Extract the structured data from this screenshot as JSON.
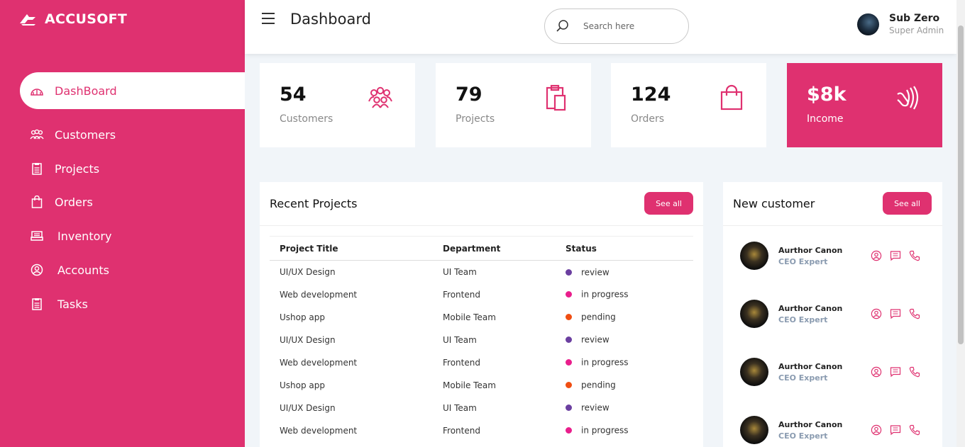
{
  "brand": {
    "name": "ACCUSOFT"
  },
  "colors": {
    "accent": "#df3170",
    "background": "#f1f5f9"
  },
  "sidebar": {
    "items": [
      {
        "label": "DashBoard",
        "icon": "dashboard-icon",
        "active": true
      },
      {
        "label": "Customers",
        "icon": "customers-icon"
      },
      {
        "label": "Projects",
        "icon": "projects-icon"
      },
      {
        "label": "Orders",
        "icon": "orders-icon"
      },
      {
        "label": "Inventory",
        "icon": "inventory-icon"
      },
      {
        "label": "Accounts",
        "icon": "accounts-icon"
      },
      {
        "label": "Tasks",
        "icon": "tasks-icon"
      }
    ]
  },
  "header": {
    "title": "Dashboard",
    "search_placeholder": "Search here",
    "search_value": "",
    "user": {
      "name": "Sub Zero",
      "role": "Super Admin"
    }
  },
  "stats": [
    {
      "value": "54",
      "label": "Customers",
      "icon": "people-group-icon"
    },
    {
      "value": "79",
      "label": "Projects",
      "icon": "clipboard-icon"
    },
    {
      "value": "124",
      "label": "Orders",
      "icon": "shopping-bag-icon"
    },
    {
      "value": "$8k",
      "label": "Income",
      "icon": "cash-wave-icon"
    }
  ],
  "recent_projects": {
    "title": "Recent Projects",
    "see_all": "See all",
    "columns": [
      "Project Title",
      "Department",
      "Status"
    ],
    "rows": [
      {
        "title": "UI/UX Design",
        "department": "UI Team",
        "status": "review",
        "color": "#6b3fa0"
      },
      {
        "title": "Web development",
        "department": "Frontend",
        "status": "in progress",
        "color": "#e91e8c"
      },
      {
        "title": "Ushop app",
        "department": "Mobile Team",
        "status": "pending",
        "color": "#f04e12"
      },
      {
        "title": "UI/UX Design",
        "department": "UI Team",
        "status": "review",
        "color": "#6b3fa0"
      },
      {
        "title": "Web development",
        "department": "Frontend",
        "status": "in progress",
        "color": "#e91e8c"
      },
      {
        "title": "Ushop app",
        "department": "Mobile Team",
        "status": "pending",
        "color": "#f04e12"
      },
      {
        "title": "UI/UX Design",
        "department": "UI Team",
        "status": "review",
        "color": "#6b3fa0"
      },
      {
        "title": "Web development",
        "department": "Frontend",
        "status": "in progress",
        "color": "#e91e8c"
      }
    ]
  },
  "new_customer": {
    "title": "New customer",
    "see_all": "See all",
    "customers": [
      {
        "name": "Aurthor Canon",
        "role": "CEO Expert"
      },
      {
        "name": "Aurthor Canon",
        "role": "CEO Expert"
      },
      {
        "name": "Aurthor Canon",
        "role": "CEO Expert"
      },
      {
        "name": "Aurthor Canon",
        "role": "CEO Expert"
      }
    ]
  }
}
